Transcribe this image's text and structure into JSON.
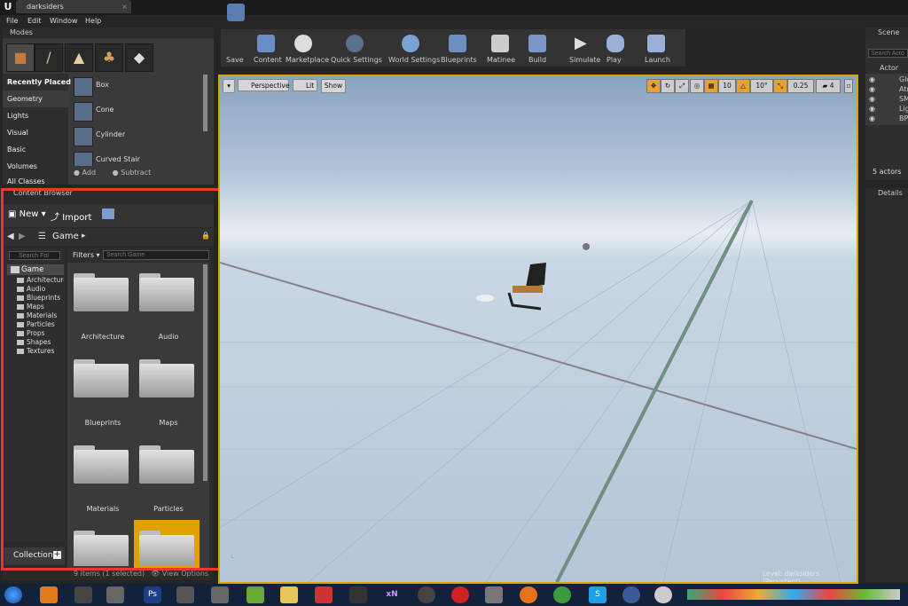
{
  "app": {
    "logo": "U",
    "doc_tab": "darksiders",
    "tab_close": "×"
  },
  "menu": [
    "File",
    "Edit",
    "Window",
    "Help"
  ],
  "modes": {
    "title": "Modes",
    "categories": [
      "Recently Placed",
      "Geometry",
      "Lights",
      "Visual",
      "Basic",
      "Volumes",
      "All Classes"
    ],
    "shapes": [
      "Box",
      "Cone",
      "Cylinder",
      "Curved Stair"
    ],
    "add_label": "Add",
    "subtract_label": "Subtract"
  },
  "toolbar": {
    "buttons": [
      {
        "label": "Save",
        "icon": "save-icon"
      },
      {
        "label": "Content",
        "icon": "content-icon"
      },
      {
        "label": "Marketplace",
        "icon": "marketplace-icon"
      },
      {
        "label": "Quick Settings",
        "icon": "settings-icon"
      },
      {
        "label": "World Settings",
        "icon": "world-icon"
      },
      {
        "label": "Blueprints",
        "icon": "blueprint-icon"
      },
      {
        "label": "Matinee",
        "icon": "matinee-icon"
      },
      {
        "label": "Build",
        "icon": "build-icon"
      },
      {
        "label": "Simulate",
        "icon": "simulate-icon"
      },
      {
        "label": "Play",
        "icon": "play-icon"
      },
      {
        "label": "Launch",
        "icon": "launch-icon"
      }
    ]
  },
  "content_browser": {
    "title": "Content Browser",
    "new_label": "New",
    "import_label": "Import",
    "path": "Game",
    "search_folders_placeholder": "Search Fol",
    "filters_label": "Filters",
    "search_game_placeholder": "Search Game",
    "tree": [
      "Game",
      "Architecture",
      "Audio",
      "Blueprints",
      "Maps",
      "Materials",
      "Particles",
      "Props",
      "Shapes",
      "Textures"
    ],
    "folders": [
      "Architecture",
      "Audio",
      "Blueprints",
      "Maps",
      "Materials",
      "Particles",
      "",
      ""
    ],
    "collections_label": "Collection",
    "status": "9 items (1 selected)",
    "view_options": "View Options"
  },
  "viewport": {
    "perspective": "Perspective",
    "lit": "Lit",
    "show": "Show",
    "grid_snap": "10",
    "rot_snap": "10°",
    "scale_snap": "0.25",
    "cam_speed": "4",
    "level_label": "Level:",
    "level_name": "darksiders (Persistent)"
  },
  "outliner": {
    "title": "Scene Ou",
    "search_placeholder": "Search Acto",
    "column": "Actor",
    "rows": [
      "Glo",
      "Atr",
      "SM",
      "Lig",
      "BP"
    ],
    "actor_count": "5 actors"
  },
  "details": {
    "title": "Details"
  },
  "taskbar": {
    "icons": [
      "start-icon",
      "media-icon",
      "app-icon",
      "steam-icon",
      "aluminum-icon",
      "steam-store-icon",
      "notepad-icon",
      "explorer-icon",
      "filezilla-icon",
      "photoshop-icon",
      "ue-icon",
      "xn-icon",
      "obs-icon",
      "vpn-icon",
      "zbrush-icon",
      "firefox-icon",
      "chrome-icon",
      "skype-icon",
      "unreal-icon",
      "unreal-active-icon"
    ],
    "ps_text": "Ps",
    "xn_text": "xN",
    "s_text": "S"
  }
}
